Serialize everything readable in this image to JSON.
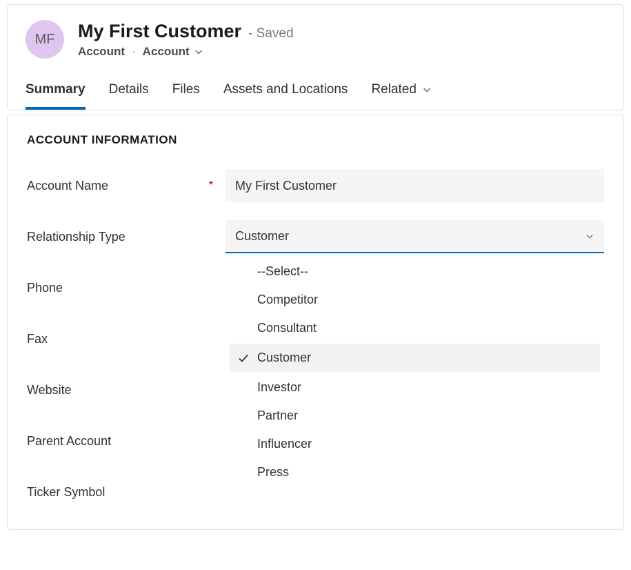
{
  "header": {
    "avatar_initials": "MF",
    "title": "My First Customer",
    "save_state": "- Saved",
    "entity_label": "Account",
    "separator": "·",
    "form_type": "Account"
  },
  "tabs": [
    {
      "label": "Summary",
      "active": true
    },
    {
      "label": "Details",
      "active": false
    },
    {
      "label": "Files",
      "active": false
    },
    {
      "label": "Assets and Locations",
      "active": false
    },
    {
      "label": "Related",
      "active": false,
      "has_chevron": true
    }
  ],
  "section_title": "ACCOUNT INFORMATION",
  "fields": {
    "account_name": {
      "label": "Account Name",
      "value": "My First Customer",
      "required": true
    },
    "relationship_type": {
      "label": "Relationship Type",
      "value": "Customer",
      "required": false
    },
    "phone": {
      "label": "Phone"
    },
    "fax": {
      "label": "Fax"
    },
    "website": {
      "label": "Website"
    },
    "parent_account": {
      "label": "Parent Account"
    },
    "ticker_symbol": {
      "label": "Ticker Symbol"
    }
  },
  "dropdown_options": [
    {
      "label": "--Select--",
      "selected": false
    },
    {
      "label": "Competitor",
      "selected": false
    },
    {
      "label": "Consultant",
      "selected": false
    },
    {
      "label": "Customer",
      "selected": true
    },
    {
      "label": "Investor",
      "selected": false
    },
    {
      "label": "Partner",
      "selected": false
    },
    {
      "label": "Influencer",
      "selected": false
    },
    {
      "label": "Press",
      "selected": false
    }
  ]
}
